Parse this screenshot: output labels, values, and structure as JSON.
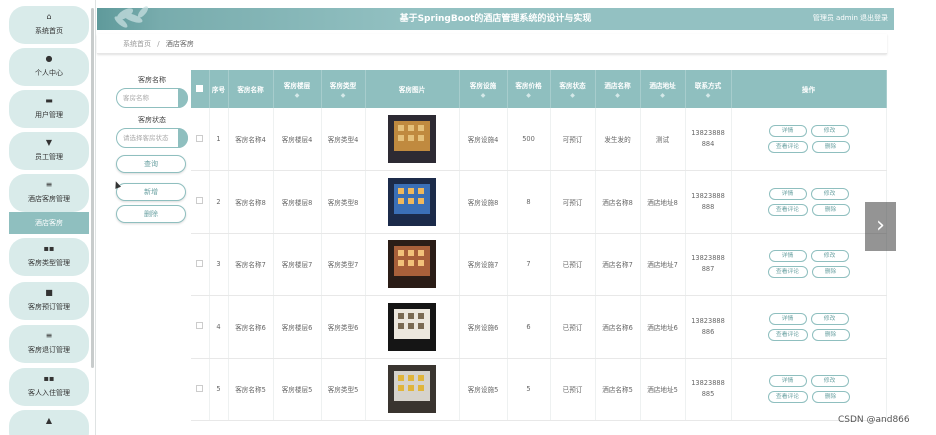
{
  "header": {
    "title": "基于SpringBoot的酒店管理系统的设计与实现",
    "user": "管理员 admin",
    "logout": "退出登录"
  },
  "breadcrumb": {
    "home": "系统首页",
    "sep": "/",
    "current": "酒店客房"
  },
  "sidebar": {
    "items": [
      {
        "icon": "home-icon",
        "glyph": "⌂",
        "label": "系统首页"
      },
      {
        "icon": "user-icon",
        "glyph": "●",
        "label": "个人中心"
      },
      {
        "icon": "briefcase-icon",
        "glyph": "▬",
        "label": "用户管理"
      },
      {
        "icon": "trophy-icon",
        "glyph": "▼",
        "label": "员工管理"
      },
      {
        "icon": "menu-icon",
        "glyph": "≡",
        "label": "酒店客房管理"
      },
      {
        "icon": "grid-icon",
        "glyph": "▪▪",
        "label": "客房类型管理"
      },
      {
        "icon": "clipboard-icon",
        "glyph": "■",
        "label": "客房预订管理"
      },
      {
        "icon": "menu-icon",
        "glyph": "≡",
        "label": "客房退订管理"
      },
      {
        "icon": "grid-icon",
        "glyph": "▪▪",
        "label": "客人入住管理"
      },
      {
        "icon": "tool-icon",
        "glyph": "▲",
        "label": ""
      }
    ],
    "sub_item": "酒店客房"
  },
  "filters": {
    "name_label": "客房名称",
    "name_placeholder": "客房名称",
    "status_label": "客房状态",
    "status_placeholder": "请选择客房状态",
    "search": "查询",
    "add": "新增",
    "delete": "删除"
  },
  "table": {
    "columns": [
      "序号",
      "客房名称",
      "客房楼层",
      "客房类型",
      "客房图片",
      "客房设施",
      "客房价格",
      "客房状态",
      "酒店名称",
      "酒店地址",
      "联系方式",
      "操作"
    ],
    "rows": [
      {
        "no": "1",
        "name": "客房名称4",
        "floor": "客房楼层4",
        "type": "客房类型4",
        "facility": "客房设施4",
        "price": "500",
        "status": "可预订",
        "hotel": "发生发的",
        "address": "测试",
        "phone": "13823888884"
      },
      {
        "no": "2",
        "name": "客房名称8",
        "floor": "客房楼层8",
        "type": "客房类型8",
        "facility": "客房设施8",
        "price": "8",
        "status": "可预订",
        "hotel": "酒店名称8",
        "address": "酒店地址8",
        "phone": "13823888888"
      },
      {
        "no": "3",
        "name": "客房名称7",
        "floor": "客房楼层7",
        "type": "客房类型7",
        "facility": "客房设施7",
        "price": "7",
        "status": "已预订",
        "hotel": "酒店名称7",
        "address": "酒店地址7",
        "phone": "13823888887"
      },
      {
        "no": "4",
        "name": "客房名称6",
        "floor": "客房楼层6",
        "type": "客房类型6",
        "facility": "客房设施6",
        "price": "6",
        "status": "已预订",
        "hotel": "酒店名称6",
        "address": "酒店地址6",
        "phone": "13823888886"
      },
      {
        "no": "5",
        "name": "客房名称5",
        "floor": "客房楼层5",
        "type": "客房类型5",
        "facility": "客房设施5",
        "price": "5",
        "status": "已预订",
        "hotel": "酒店名称5",
        "address": "酒店地址5",
        "phone": "13823888885"
      }
    ],
    "ops": {
      "detail": "详情",
      "edit": "修改",
      "comment": "查看评论",
      "delete": "删除"
    }
  },
  "watermark": "CSDN @and866"
}
